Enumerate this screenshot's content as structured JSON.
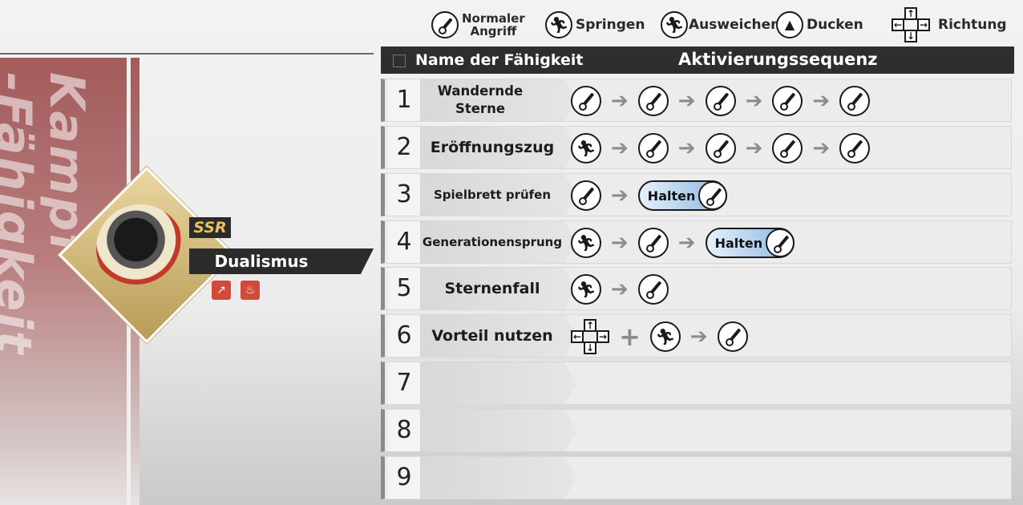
{
  "legend": {
    "normal_attack": "Normaler\nAngriff",
    "jump": "Springen",
    "dodge": "Ausweichen",
    "duck": "Ducken",
    "direction": "Richtung"
  },
  "side_title": "Kampf\n-Fähigkeit",
  "character": {
    "rarity": "SSR",
    "name": "Dualismus"
  },
  "table": {
    "header_name": "Name der Fähigkeit",
    "header_sequence": "Aktivierungssequenz",
    "hold_label": "Halten",
    "rows": [
      {
        "num": "1",
        "name": "Wandernde Sterne",
        "sequence": [
          "attack",
          "attack",
          "attack",
          "attack",
          "attack"
        ]
      },
      {
        "num": "2",
        "name": "Eröffnungszug",
        "sequence": [
          "jump",
          "attack",
          "attack",
          "attack",
          "attack"
        ]
      },
      {
        "num": "3",
        "name": "Spielbrett prüfen",
        "sequence": [
          "attack",
          "hold-attack"
        ]
      },
      {
        "num": "4",
        "name": "Generationensprung",
        "sequence": [
          "jump",
          "attack",
          "hold-attack"
        ]
      },
      {
        "num": "5",
        "name": "Sternenfall",
        "sequence": [
          "dodge",
          "attack"
        ]
      },
      {
        "num": "6",
        "name": "Vorteil nutzen",
        "sequence": [
          "direction",
          "+",
          "dodge",
          "attack"
        ]
      },
      {
        "num": "7",
        "name": "",
        "sequence": []
      },
      {
        "num": "8",
        "name": "",
        "sequence": []
      },
      {
        "num": "9",
        "name": "",
        "sequence": []
      }
    ]
  },
  "colors": {
    "header_bg": "#2e2e2e",
    "side_panel": "#a35b5b",
    "hold_fill": "#8ab5e2",
    "ssr_text": "#e8c15a"
  }
}
